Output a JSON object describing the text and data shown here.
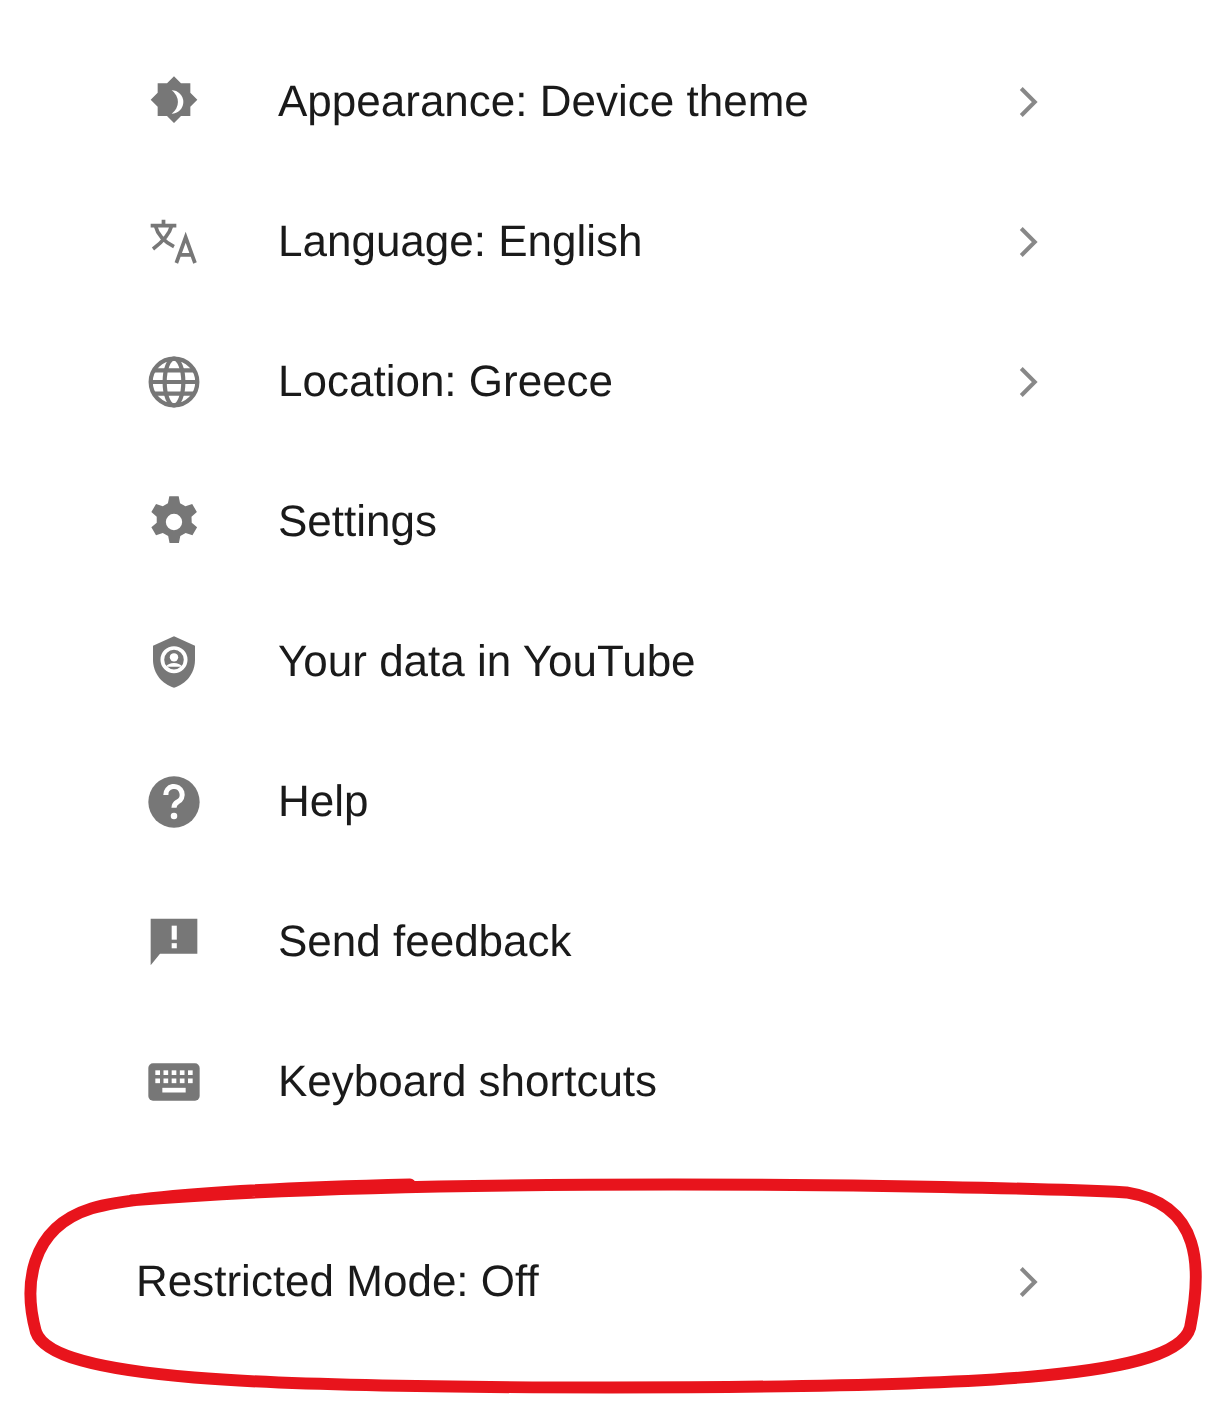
{
  "menu": {
    "items": [
      {
        "label": "Appearance: Device theme",
        "kind": "icon",
        "submenu": true
      },
      {
        "label": "Language: English",
        "kind": "icon",
        "submenu": true
      },
      {
        "label": "Location: Greece",
        "kind": "icon",
        "submenu": true
      },
      {
        "label": "Settings",
        "kind": "icon",
        "submenu": false
      },
      {
        "label": "Your data in YouTube",
        "kind": "icon",
        "submenu": false
      },
      {
        "label": "Help",
        "kind": "icon",
        "submenu": false
      },
      {
        "label": "Send feedback",
        "kind": "icon",
        "submenu": false
      },
      {
        "label": "Keyboard shortcuts",
        "kind": "icon",
        "submenu": false
      },
      {
        "label": "Restricted Mode: Off",
        "kind": "plain",
        "submenu": true
      }
    ]
  },
  "annotation": {
    "kind": "ellipse",
    "color": "#e8141c"
  }
}
